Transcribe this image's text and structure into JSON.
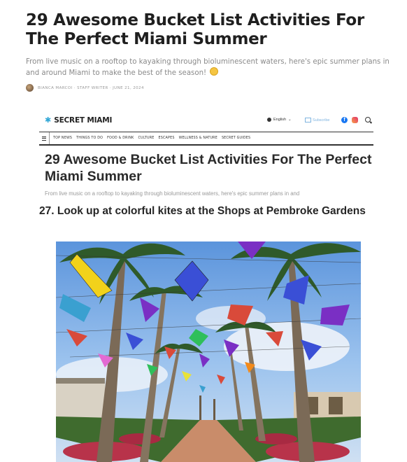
{
  "article": {
    "title": "29 Awesome Bucket List Activities For The Perfect Miami Summer",
    "subtitle": "From live music on a rooftop to kayaking through bioluminescent waters, here's epic summer plans in and around Miami to make the best of the season!",
    "byline": "BIANCA MARCOI · STAFF WRITER · JUNE 21, 2024"
  },
  "embed": {
    "site_name": "SECRET MIAMI",
    "language": "English",
    "subscribe": "Subscribe",
    "nav": [
      "TOP NEWS",
      "THINGS TO DO",
      "FOOD & DRINK",
      "CULTURE",
      "ESCAPES",
      "WELLNESS & NATURE",
      "SECRET GUIDES"
    ],
    "title": "29 Awesome Bucket List Activities For The Perfect Miami Summer",
    "subtitle": "From live music on a rooftop to kayaking through bioluminescent waters, here's epic summer plans in and",
    "section_heading": "27. Look up at colorful kites at the Shops at Pembroke Gardens"
  },
  "icons": {
    "logo": "sun-star-icon",
    "globe": "globe-icon",
    "mail": "mail-icon",
    "facebook": "facebook-icon",
    "instagram": "instagram-icon",
    "search": "search-icon",
    "menu": "hamburger-icon"
  },
  "colors": {
    "brand": "#2fa6d6",
    "sky": "#6fa8e6",
    "kite_yellow": "#f2d21b",
    "kite_blue": "#3a4fd6",
    "kite_red": "#d94a3a",
    "kite_purple": "#7a2fc4"
  }
}
